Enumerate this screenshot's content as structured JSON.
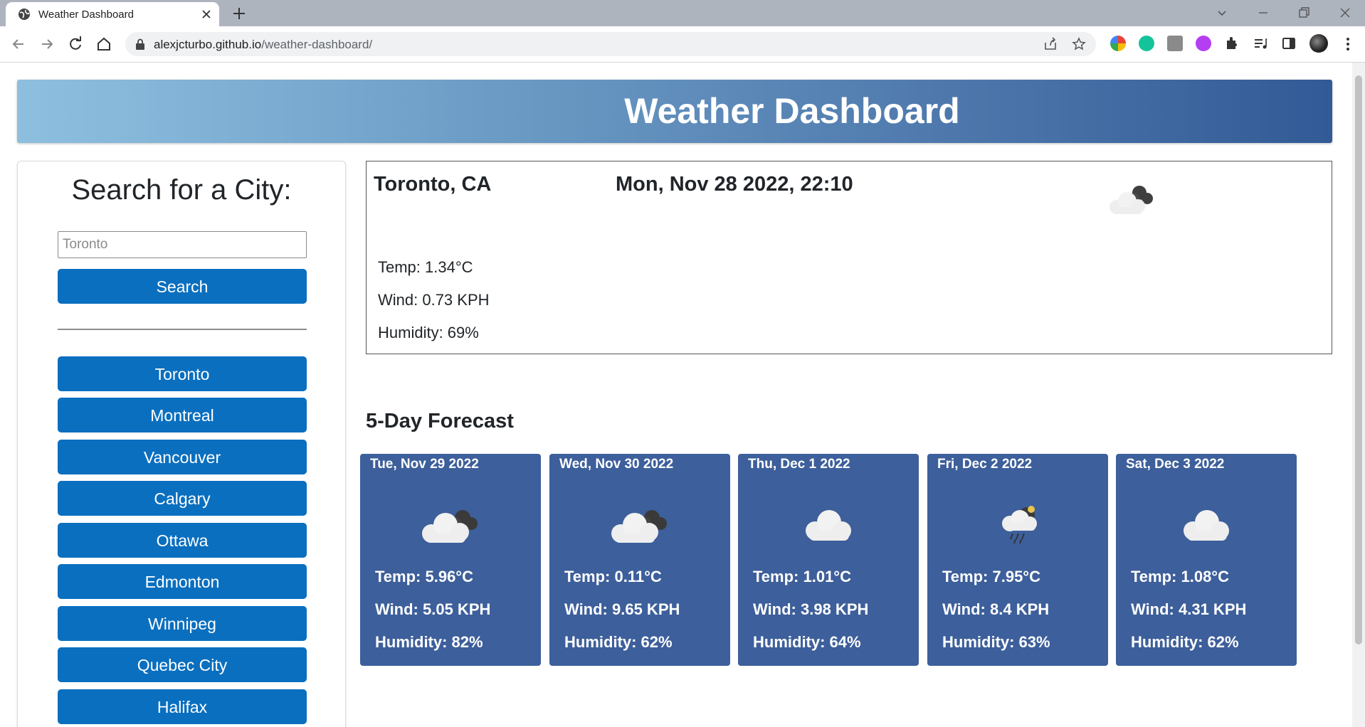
{
  "browser": {
    "tab_title": "Weather Dashboard",
    "url_domain": "alexjcturbo.github.io",
    "url_path": "/weather-dashboard/"
  },
  "page": {
    "title": "Weather Dashboard",
    "sidebar": {
      "heading": "Search for a City:",
      "search_placeholder": "Toronto",
      "search_button": "Search",
      "cities": [
        "Toronto",
        "Montreal",
        "Vancouver",
        "Calgary",
        "Ottawa",
        "Edmonton",
        "Winnipeg",
        "Quebec City",
        "Halifax"
      ]
    },
    "current": {
      "city": "Toronto, CA",
      "datetime": "Mon, Nov 28 2022, 22:10",
      "icon": "cloud-night-icon",
      "temp": "Temp: 1.34°C",
      "wind": "Wind: 0.73 KPH",
      "humidity": "Humidity: 69%"
    },
    "forecast_title": "5-Day Forecast",
    "forecast": [
      {
        "date": "Tue, Nov 29 2022",
        "icon": "broken-clouds-icon",
        "temp": "Temp: 5.96°C",
        "wind": "Wind: 5.05 KPH",
        "humidity": "Humidity: 82%"
      },
      {
        "date": "Wed, Nov 30 2022",
        "icon": "broken-clouds-icon",
        "temp": "Temp: 0.11°C",
        "wind": "Wind: 9.65 KPH",
        "humidity": "Humidity: 62%"
      },
      {
        "date": "Thu, Dec 1 2022",
        "icon": "cloud-icon",
        "temp": "Temp: 1.01°C",
        "wind": "Wind: 3.98 KPH",
        "humidity": "Humidity: 64%"
      },
      {
        "date": "Fri, Dec 2 2022",
        "icon": "rain-cloud-icon",
        "temp": "Temp: 7.95°C",
        "wind": "Wind: 8.4 KPH",
        "humidity": "Humidity: 63%"
      },
      {
        "date": "Sat, Dec 3 2022",
        "icon": "cloud-icon",
        "temp": "Temp: 1.08°C",
        "wind": "Wind: 4.31 KPH",
        "humidity": "Humidity: 62%"
      }
    ]
  },
  "colors": {
    "header_gradient_start": "#8fbfdf",
    "header_gradient_end": "#325a96",
    "button_blue": "#0a6fbf",
    "card_blue": "#3d5f9b"
  }
}
